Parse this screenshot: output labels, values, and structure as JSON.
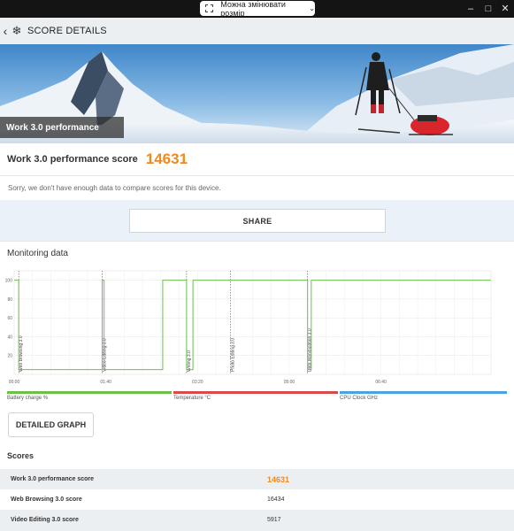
{
  "window": {
    "resize_label": "Можна змінювати розмір",
    "minimize": "–",
    "maximize": "□",
    "close": "✕"
  },
  "appbar": {
    "title": "SCORE DETAILS"
  },
  "banner": {
    "label": "Work 3.0 performance"
  },
  "result": {
    "label": "Work 3.0 performance score",
    "value": "14631",
    "compare_message": "Sorry, we don't have enough data to compare scores for this device."
  },
  "share": {
    "label": "SHARE"
  },
  "monitoring": {
    "title": "Monitoring data",
    "legend": [
      {
        "label": "Battery charge %",
        "color": "#6cc04a"
      },
      {
        "label": "Temperature °C",
        "color": "#d94b4b"
      },
      {
        "label": "CPU Clock GHz",
        "color": "#4aa3df"
      }
    ],
    "detail_button": "DETAILED GRAPH"
  },
  "chart_data": {
    "type": "line",
    "x_unit": "time (mm:ss)",
    "x_ticks": [
      "00:00",
      "01:40",
      "03:20",
      "05:00",
      "06:40"
    ],
    "y_ticks": [
      "20",
      "40",
      "60",
      "80",
      "100"
    ],
    "ylim": [
      0,
      110
    ],
    "xlim": [
      0,
      520
    ],
    "grid": true,
    "series": [
      {
        "name": "Battery charge %",
        "color": "#6cc04a",
        "x": [
          0,
          5,
          5,
          96,
          96,
          98,
          98,
          162,
          162,
          163,
          163,
          188,
          188,
          195,
          195,
          320,
          320,
          324,
          324,
          520
        ],
        "y": [
          100,
          100,
          5,
          5,
          100,
          100,
          5,
          5,
          100,
          100,
          100,
          100,
          5,
          5,
          100,
          100,
          5,
          5,
          100,
          100
        ]
      }
    ],
    "segments": [
      {
        "label": "Web Browsing 3.0",
        "x": 5
      },
      {
        "label": "Video Editing 3.0",
        "x": 96
      },
      {
        "label": "Writing 3.0",
        "x": 188
      },
      {
        "label": "Photo Editing 3.0",
        "x": 236
      },
      {
        "label": "Data Manipulation 3.0",
        "x": 320
      }
    ]
  },
  "scores": {
    "title": "Scores",
    "rows": [
      {
        "label": "Work 3.0 performance score",
        "value": "14631"
      },
      {
        "label": "Web Browsing 3.0 score",
        "value": "16434"
      },
      {
        "label": "Video Editing 3.0 score",
        "value": "5917"
      }
    ]
  }
}
